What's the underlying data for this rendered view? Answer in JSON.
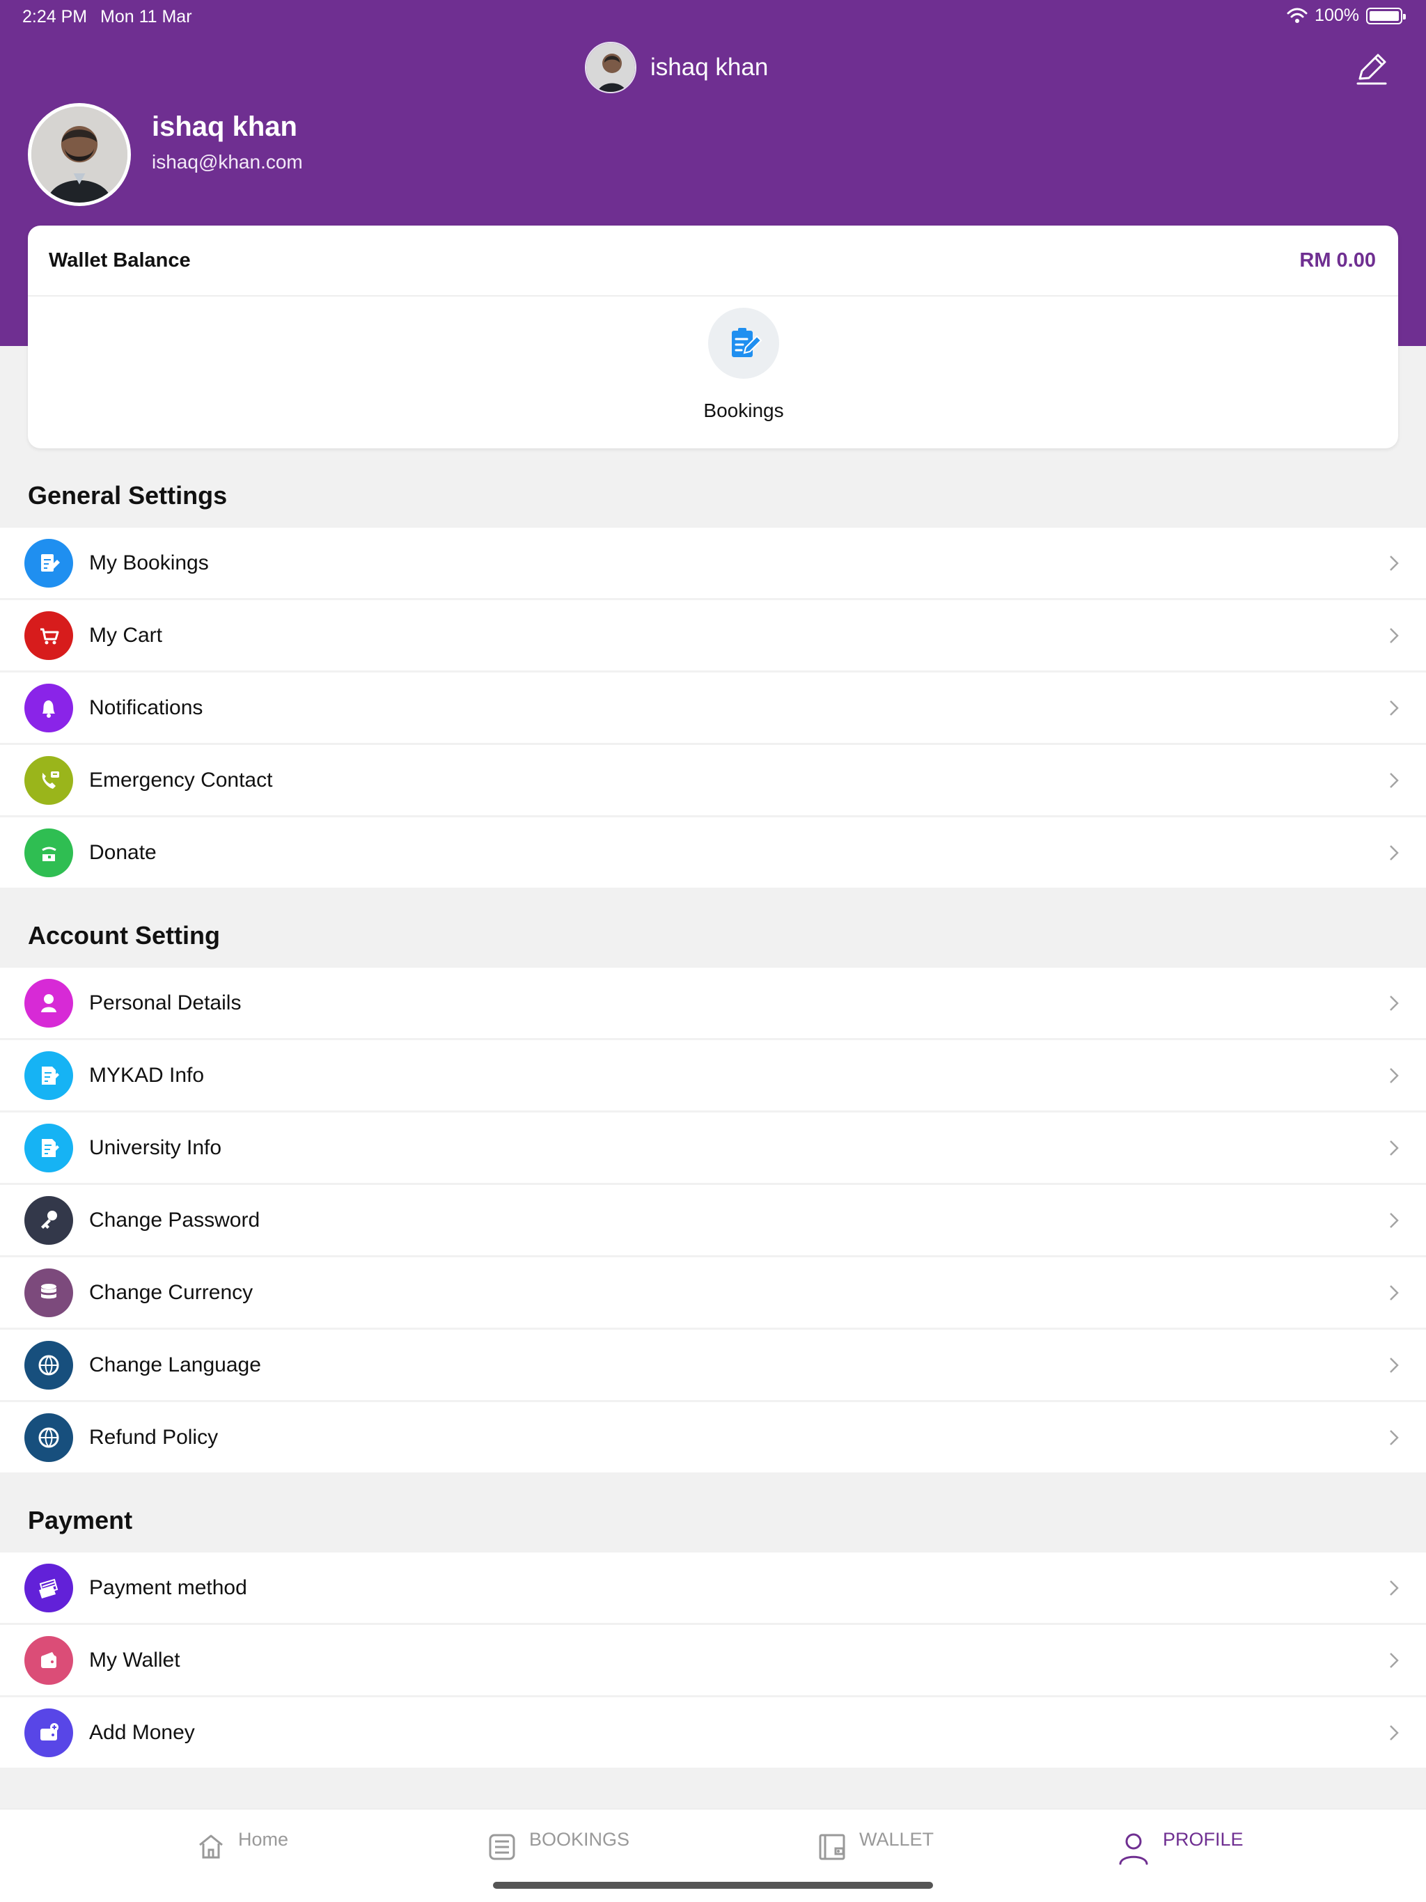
{
  "status": {
    "time": "2:24 PM",
    "date": "Mon 11 Mar",
    "battery": "100%"
  },
  "header": {
    "name": "ishaq khan",
    "email": "ishaq@khan.com"
  },
  "wallet": {
    "label": "Wallet Balance",
    "value": "RM 0.00"
  },
  "shortcuts": [
    {
      "label": "Bookings",
      "icon": "bookings-icon"
    }
  ],
  "sections": {
    "general": {
      "title": "General Settings",
      "items": [
        {
          "label": "My Bookings",
          "icon": "clipboard-edit-icon",
          "color": "#1f8ff0"
        },
        {
          "label": "My Cart",
          "icon": "cart-icon",
          "color": "#d71c1c"
        },
        {
          "label": "Notifications",
          "icon": "bell-icon",
          "color": "#8a24e8"
        },
        {
          "label": "Emergency Contact",
          "icon": "emergency-contact-icon",
          "color": "#9ab51b"
        },
        {
          "label": "Donate",
          "icon": "donate-icon",
          "color": "#2fbe52"
        }
      ]
    },
    "account": {
      "title": "Account Setting",
      "items": [
        {
          "label": "Personal Details",
          "icon": "person-icon",
          "color": "#d72ad6"
        },
        {
          "label": "MYKAD Info",
          "icon": "document-edit-icon",
          "color": "#16b3f4"
        },
        {
          "label": "University Info",
          "icon": "document-edit-icon",
          "color": "#16b3f4"
        },
        {
          "label": "Change Password",
          "icon": "key-icon",
          "color": "#33384a"
        },
        {
          "label": "Change Currency",
          "icon": "coins-icon",
          "color": "#7c4a7c"
        },
        {
          "label": "Change Language",
          "icon": "globe-icon",
          "color": "#174f7d"
        },
        {
          "label": "Refund Policy",
          "icon": "globe-icon",
          "color": "#174f7d"
        }
      ]
    },
    "payment": {
      "title": "Payment",
      "items": [
        {
          "label": "Payment method",
          "icon": "cards-icon",
          "color": "#6221d8"
        },
        {
          "label": "My Wallet",
          "icon": "wallet-icon",
          "color": "#db4d77"
        },
        {
          "label": "Add Money",
          "icon": "add-money-icon",
          "color": "#5846e7"
        }
      ]
    }
  },
  "tabs": [
    {
      "label": "Home",
      "icon": "home-icon"
    },
    {
      "label": "BOOKINGS",
      "icon": "bookings-tab-icon"
    },
    {
      "label": "WALLET",
      "icon": "wallet-tab-icon"
    },
    {
      "label": "PROFILE",
      "icon": "profile-icon"
    }
  ],
  "colors": {
    "brand": "#6f2f91",
    "background": "#f1f1f1"
  }
}
